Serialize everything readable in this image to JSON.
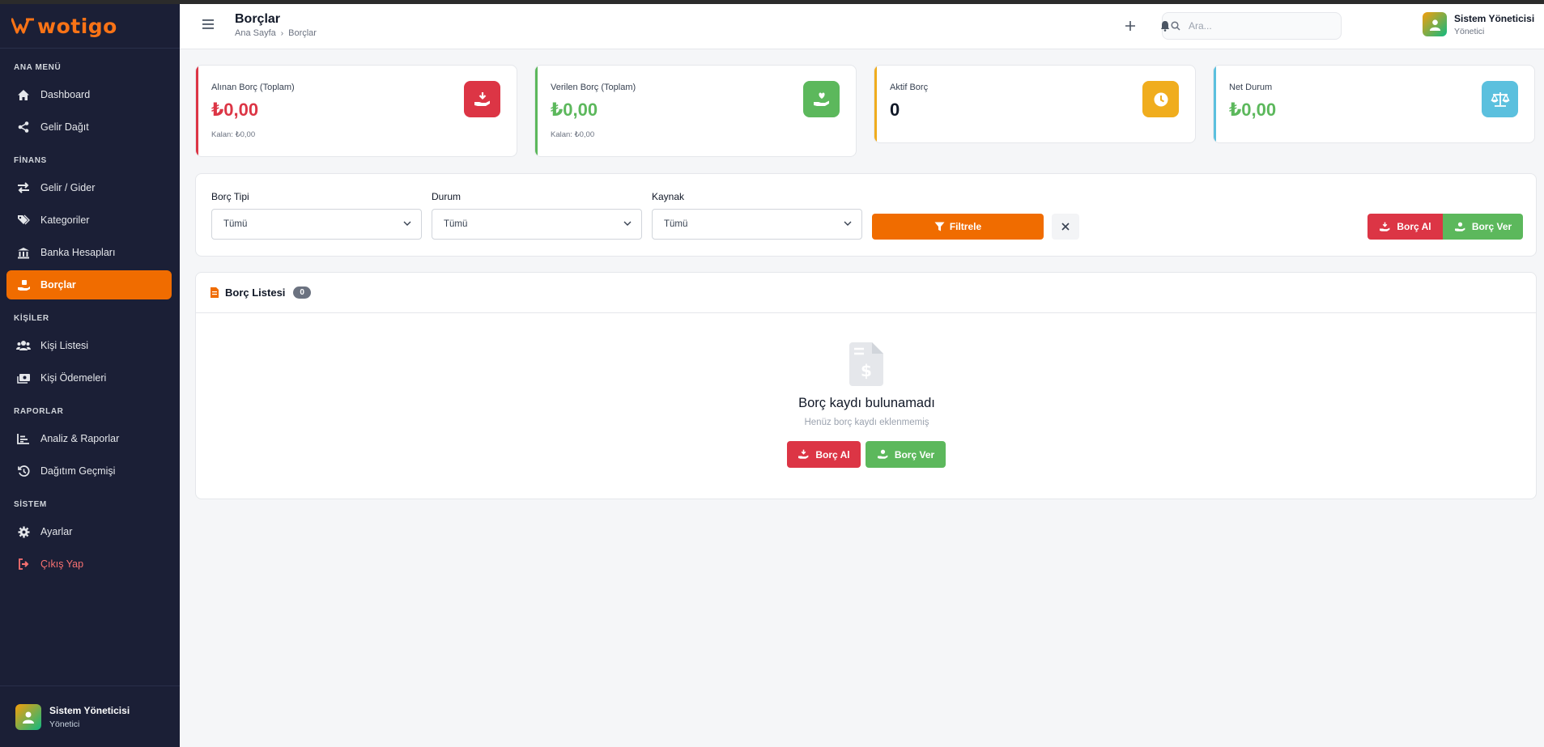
{
  "brand": {
    "name": "wotigo",
    "color": "#f97316"
  },
  "sidebar": {
    "sections": [
      {
        "title": "ANA MENÜ",
        "items": [
          {
            "label": "Dashboard",
            "icon": "home-icon"
          },
          {
            "label": "Gelir Dağıt",
            "icon": "share-icon"
          }
        ]
      },
      {
        "title": "FİNANS",
        "items": [
          {
            "label": "Gelir / Gider",
            "icon": "exchange-icon"
          },
          {
            "label": "Kategoriler",
            "icon": "tags-icon"
          },
          {
            "label": "Banka Hesapları",
            "icon": "bank-icon"
          },
          {
            "label": "Borçlar",
            "icon": "hand-holding-dollar-icon",
            "active": true
          }
        ]
      },
      {
        "title": "KİŞİLER",
        "items": [
          {
            "label": "Kişi Listesi",
            "icon": "users-icon"
          },
          {
            "label": "Kişi Ödemeleri",
            "icon": "money-bill-icon"
          }
        ]
      },
      {
        "title": "RAPORLAR",
        "items": [
          {
            "label": "Analiz & Raporlar",
            "icon": "chart-icon"
          },
          {
            "label": "Dağıtım Geçmişi",
            "icon": "history-icon"
          }
        ]
      },
      {
        "title": "SİSTEM",
        "items": [
          {
            "label": "Ayarlar",
            "icon": "gear-icon"
          },
          {
            "label": "Çıkış Yap",
            "icon": "logout-icon",
            "danger": true
          }
        ]
      }
    ],
    "user": {
      "name": "Sistem Yöneticisi",
      "role": "Yönetici"
    }
  },
  "header": {
    "title": "Borçlar",
    "breadcrumb": {
      "home": "Ana Sayfa",
      "current": "Borçlar"
    },
    "search_placeholder": "Ara...",
    "user": {
      "name": "Sistem Yöneticisi",
      "role": "Yönetici"
    }
  },
  "stats": [
    {
      "label": "Alınan Borç (Toplam)",
      "value": "₺0,00",
      "sub": "Kalan: ₺0,00",
      "color": "#dc3545",
      "icon": "hand-receive-icon"
    },
    {
      "label": "Verilen Borç (Toplam)",
      "value": "₺0,00",
      "sub": "Kalan: ₺0,00",
      "color": "#5cb85c",
      "icon": "hand-heart-icon"
    },
    {
      "label": "Aktif Borç",
      "value": "0",
      "sub": "",
      "color": "#f0ad1e",
      "icon": "clock-icon"
    },
    {
      "label": "Net Durum",
      "value": "₺0,00",
      "sub": "",
      "color": "#5bc0de",
      "icon": "scale-icon"
    }
  ],
  "filters": {
    "type": {
      "label": "Borç Tipi",
      "value": "Tümü"
    },
    "status": {
      "label": "Durum",
      "value": "Tümü"
    },
    "source": {
      "label": "Kaynak",
      "value": "Tümü"
    },
    "filter_button": "Filtrele",
    "borrow_button": "Borç Al",
    "lend_button": "Borç Ver"
  },
  "list": {
    "title": "Borç Listesi",
    "count": "0",
    "empty_title": "Borç kaydı bulunamadı",
    "empty_sub": "Henüz borç kaydı eklenmemiş",
    "borrow_button": "Borç Al",
    "lend_button": "Borç Ver"
  },
  "colors": {
    "accent": "#f06c00",
    "sidebar_bg": "#1b1f36",
    "danger": "#dc3545",
    "success": "#5cb85c"
  }
}
